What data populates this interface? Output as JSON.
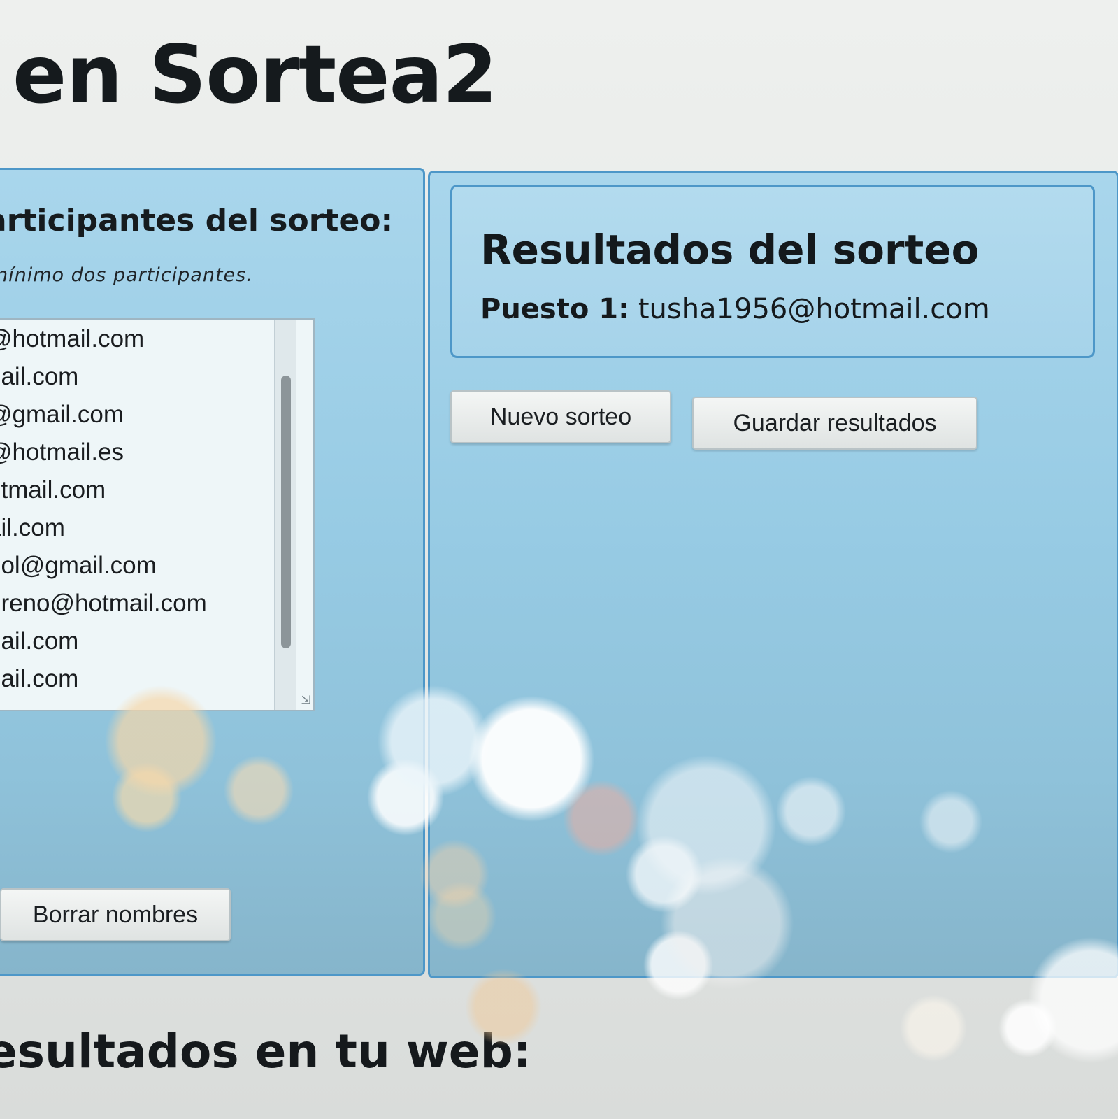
{
  "header": {
    "title": "en Sortea2"
  },
  "participants": {
    "heading": "articipantes del sorteo:",
    "hint": "nínimo dos participantes.",
    "entries": [
      "@hotmail.com",
      "nail.com",
      "@gmail.com",
      "@hotmail.es",
      "otmail.com",
      "ail.com",
      "nol@gmail.com",
      "oreno@hotmail.com",
      "nail.com",
      "nail.com"
    ],
    "clear_button_label": "Borrar nombres"
  },
  "results": {
    "heading": "Resultados del sorteo",
    "position_label": "Puesto 1:",
    "winner": "tusha1956@hotmail.com",
    "new_draw_label": "Nuevo sorteo",
    "save_label": "Guardar resultados"
  },
  "footer": {
    "heading": "esultados en tu web:"
  },
  "colors": {
    "panel_border": "#4d97c8",
    "panel_fill": "#9fd0e7",
    "text": "#15191c"
  }
}
